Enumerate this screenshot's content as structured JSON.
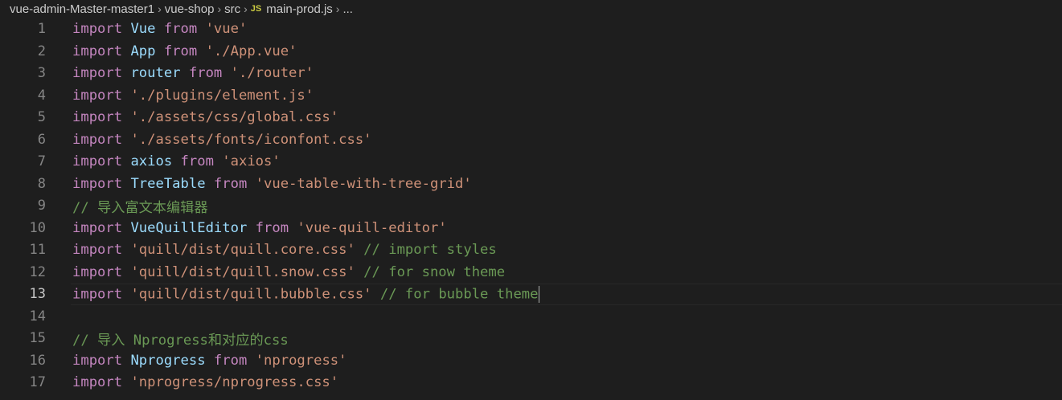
{
  "breadcrumb": {
    "items": [
      "vue-admin-Master-master1",
      "vue-shop",
      "src"
    ],
    "file_badge": "JS",
    "file": "main-prod.js",
    "more": "..."
  },
  "editor": {
    "lines": [
      {
        "n": "1",
        "t": [
          [
            "kw",
            "import "
          ],
          [
            "id",
            "Vue"
          ],
          [
            "kw",
            " from "
          ],
          [
            "str",
            "'vue'"
          ]
        ]
      },
      {
        "n": "2",
        "t": [
          [
            "kw",
            "import "
          ],
          [
            "id",
            "App"
          ],
          [
            "kw",
            " from "
          ],
          [
            "str",
            "'./App.vue'"
          ]
        ]
      },
      {
        "n": "3",
        "t": [
          [
            "kw",
            "import "
          ],
          [
            "id",
            "router"
          ],
          [
            "kw",
            " from "
          ],
          [
            "str",
            "'./router'"
          ]
        ]
      },
      {
        "n": "4",
        "t": [
          [
            "kw",
            "import "
          ],
          [
            "str",
            "'./plugins/element.js'"
          ]
        ]
      },
      {
        "n": "5",
        "t": [
          [
            "kw",
            "import "
          ],
          [
            "str",
            "'./assets/css/global.css'"
          ]
        ]
      },
      {
        "n": "6",
        "t": [
          [
            "kw",
            "import "
          ],
          [
            "str",
            "'./assets/fonts/iconfont.css'"
          ]
        ]
      },
      {
        "n": "7",
        "t": [
          [
            "kw",
            "import "
          ],
          [
            "id",
            "axios"
          ],
          [
            "kw",
            " from "
          ],
          [
            "str",
            "'axios'"
          ]
        ]
      },
      {
        "n": "8",
        "t": [
          [
            "kw",
            "import "
          ],
          [
            "id",
            "TreeTable"
          ],
          [
            "kw",
            " from "
          ],
          [
            "str",
            "'vue-table-with-tree-grid'"
          ]
        ]
      },
      {
        "n": "9",
        "t": [
          [
            "cm",
            "// 导入富文本编辑器"
          ]
        ]
      },
      {
        "n": "10",
        "t": [
          [
            "kw",
            "import "
          ],
          [
            "id",
            "VueQuillEditor"
          ],
          [
            "kw",
            " from "
          ],
          [
            "str",
            "'vue-quill-editor'"
          ]
        ]
      },
      {
        "n": "11",
        "t": [
          [
            "kw",
            "import "
          ],
          [
            "str",
            "'quill/dist/quill.core.css'"
          ],
          [
            "cm",
            " // import styles"
          ]
        ]
      },
      {
        "n": "12",
        "t": [
          [
            "kw",
            "import "
          ],
          [
            "str",
            "'quill/dist/quill.snow.css'"
          ],
          [
            "cm",
            " // for snow theme"
          ]
        ]
      },
      {
        "n": "13",
        "t": [
          [
            "kw",
            "import "
          ],
          [
            "str",
            "'quill/dist/quill.bubble.css'"
          ],
          [
            "cm",
            " // for bubble theme"
          ]
        ],
        "cursor": true
      },
      {
        "n": "14",
        "t": []
      },
      {
        "n": "15",
        "t": [
          [
            "cm",
            "// 导入 Nprogress和对应的css"
          ]
        ]
      },
      {
        "n": "16",
        "t": [
          [
            "kw",
            "import "
          ],
          [
            "id",
            "Nprogress"
          ],
          [
            "kw",
            " from "
          ],
          [
            "str",
            "'nprogress'"
          ]
        ]
      },
      {
        "n": "17",
        "t": [
          [
            "kw",
            "import "
          ],
          [
            "str",
            "'nprogress/nprogress.css'"
          ]
        ]
      }
    ]
  }
}
